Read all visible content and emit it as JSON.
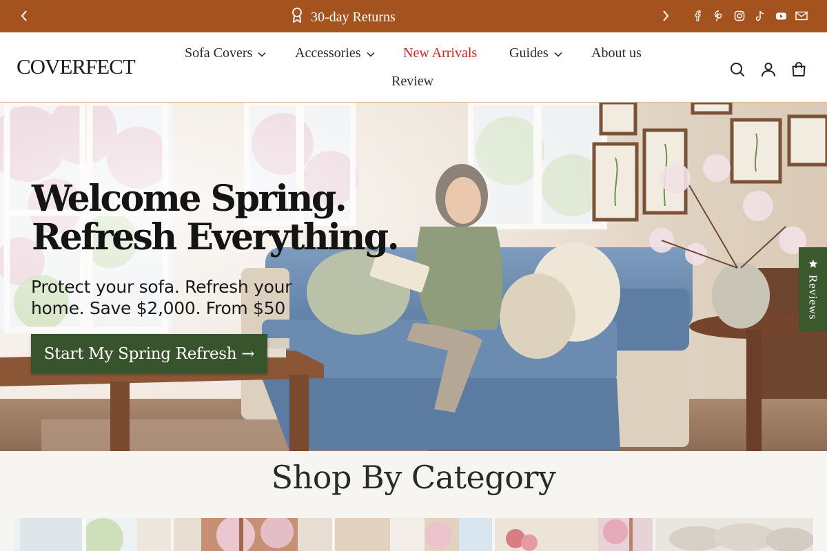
{
  "announcement": {
    "message": "30-day Returns",
    "prev_icon": "chevron-left-icon",
    "next_icon": "chevron-right-icon",
    "message_icon": "award-ribbon-icon",
    "social_icons": [
      "facebook-icon",
      "pinterest-icon",
      "instagram-icon",
      "tiktok-icon",
      "youtube-icon",
      "mail-icon"
    ],
    "background": "#a4521e"
  },
  "header": {
    "logo": "COVERFECT",
    "nav": [
      {
        "label": "Sofa Covers",
        "dropdown": true
      },
      {
        "label": "Accessories",
        "dropdown": true
      },
      {
        "label": "New Arrivals",
        "dropdown": false,
        "highlight": "#d2231f"
      },
      {
        "label": "Guides",
        "dropdown": true
      },
      {
        "label": "About us",
        "dropdown": false
      },
      {
        "label": "Review",
        "dropdown": false
      }
    ],
    "icons": [
      "search-icon",
      "account-icon",
      "cart-icon"
    ]
  },
  "hero": {
    "title_line1": "Welcome Spring.",
    "title_line2": "Refresh Everything.",
    "subtitle_line1": "Protect your sofa. Refresh your",
    "subtitle_line2": "home. Save $2,000. From $50",
    "cta_label": "Start My Spring Refresh →",
    "cta_color": "#38542c"
  },
  "reviews_tab": {
    "icon": "star-icon",
    "label": "Reviews"
  },
  "categories": {
    "title": "Shop By Category"
  }
}
